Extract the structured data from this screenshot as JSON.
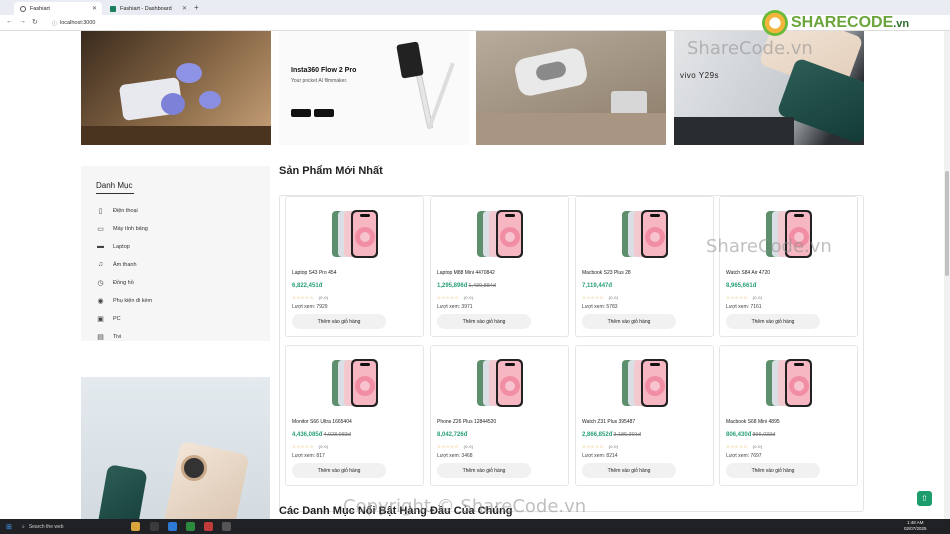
{
  "browser": {
    "tabs": [
      {
        "title": "Fashiart",
        "active": true
      },
      {
        "title": "Fashiart - Dashboard",
        "active": false
      }
    ],
    "url": "localhost:3000"
  },
  "banners": {
    "insta_title": "Insta360 Flow 2 Pro",
    "insta_subtitle": "Your pocket AI filmmaker.",
    "vivo_text": "vivo Y29s"
  },
  "sidebar": {
    "title": "Danh Mục",
    "items": [
      {
        "label": "Điện thoại",
        "icon": "phone-icon"
      },
      {
        "label": "Máy tính bảng",
        "icon": "tablet-icon"
      },
      {
        "label": "Laptop",
        "icon": "laptop-icon"
      },
      {
        "label": "Âm thanh",
        "icon": "audio-icon"
      },
      {
        "label": "Đồng hồ",
        "icon": "watch-icon"
      },
      {
        "label": "Phụ kiện đi kèm",
        "icon": "accessory-icon"
      },
      {
        "label": "PC",
        "icon": "pc-icon"
      },
      {
        "label": "Tivi",
        "icon": "tv-icon"
      }
    ]
  },
  "main": {
    "section_title": "Sản Phẩm Mới Nhất",
    "section2_title": "Các Danh Mục Nổi Bật Hàng Đầu Của Chúng",
    "add_to_cart": "Thêm vào giỏ hàng",
    "views_label": "Lượt xem:",
    "rating_text": "(0.0)",
    "products": [
      {
        "name": "Laptop S43 Pro 454",
        "price": "6,822,451đ",
        "old_price": "",
        "views": "7929"
      },
      {
        "name": "Laptop M88 Mini 4470842",
        "price": "1,295,896đ",
        "old_price": "1,439,884đ",
        "views": "3971"
      },
      {
        "name": "Macbook S23 Plus 28",
        "price": "7,119,447đ",
        "old_price": "",
        "views": "5783"
      },
      {
        "name": "Watch S84 Air 4720",
        "price": "8,965,661đ",
        "old_price": "",
        "views": "7161"
      },
      {
        "name": "Monitor S66 Ultra 1665404",
        "price": "4,436,085đ",
        "old_price": "4,928,983đ",
        "views": "817"
      },
      {
        "name": "Phone Z26 Plus 12844520",
        "price": "8,042,726đ",
        "old_price": "",
        "views": "3468"
      },
      {
        "name": "Watch Z31 Plus 395487",
        "price": "2,866,852đ",
        "old_price": "3,185,391đ",
        "views": "8214"
      },
      {
        "name": "Macbook S68 Mini 4895",
        "price": "806,430đ",
        "old_price": "896,033đ",
        "views": "7697"
      }
    ]
  },
  "taskbar": {
    "search_placeholder": "Search the web",
    "time": "1:48 AM",
    "date": "02/07/2025"
  },
  "watermark": {
    "logo": "SHARECODE",
    "logo_suffix": ".vn",
    "text1": "ShareCode.vn",
    "text2": "ShareCode.vn",
    "text3": "Copyright © ShareCode.vn"
  },
  "colors": {
    "accent": "#2aa079",
    "fab": "#1c9d6b"
  }
}
